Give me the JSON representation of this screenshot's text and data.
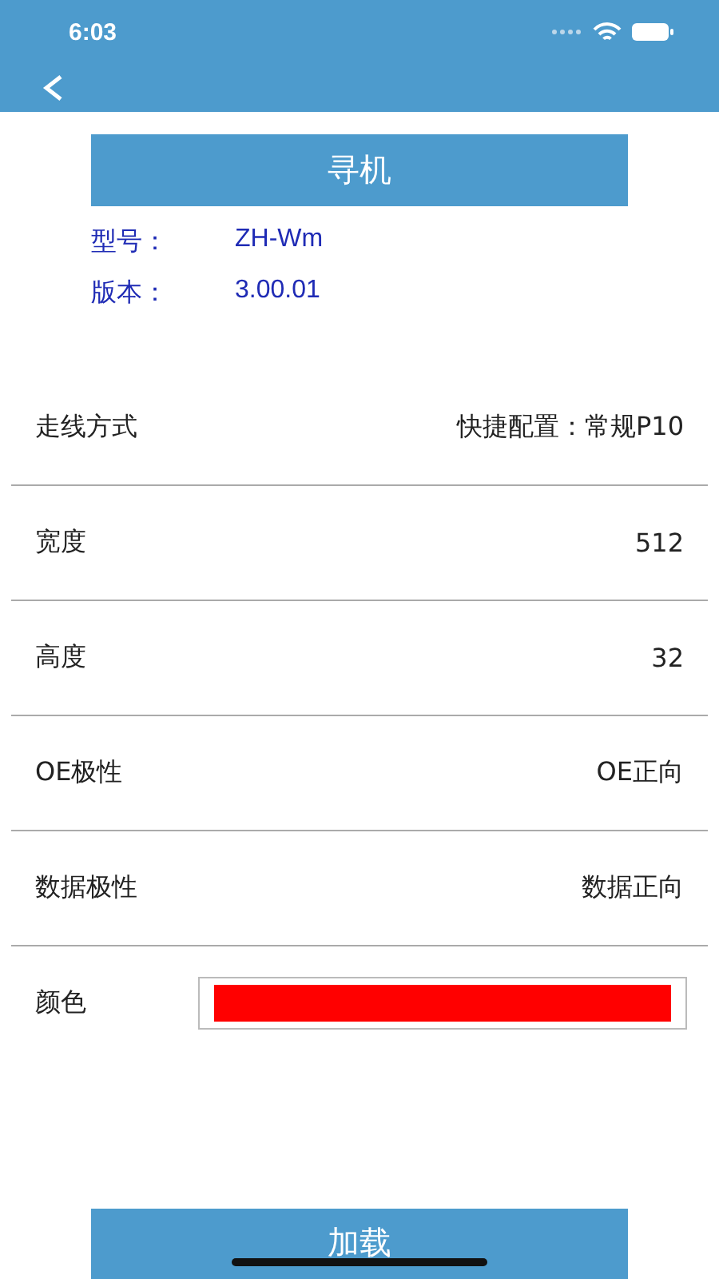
{
  "status_bar": {
    "time": "6:03"
  },
  "search_button": {
    "label": "寻机"
  },
  "info": [
    {
      "label": "型号：",
      "value": "ZH-Wm"
    },
    {
      "label": "版本：",
      "value": "3.00.01"
    }
  ],
  "settings": [
    {
      "kind": "text",
      "label": "走线方式",
      "value": "快捷配置：常规P10"
    },
    {
      "kind": "text",
      "label": "宽度",
      "value": "512"
    },
    {
      "kind": "text",
      "label": "高度",
      "value": "32"
    },
    {
      "kind": "text",
      "label": "OE极性",
      "value": "OE正向"
    },
    {
      "kind": "text",
      "label": "数据极性",
      "value": "数据正向"
    },
    {
      "kind": "color",
      "label": "颜色",
      "color": "#ff0000"
    }
  ],
  "load_button": {
    "label": "加载"
  }
}
